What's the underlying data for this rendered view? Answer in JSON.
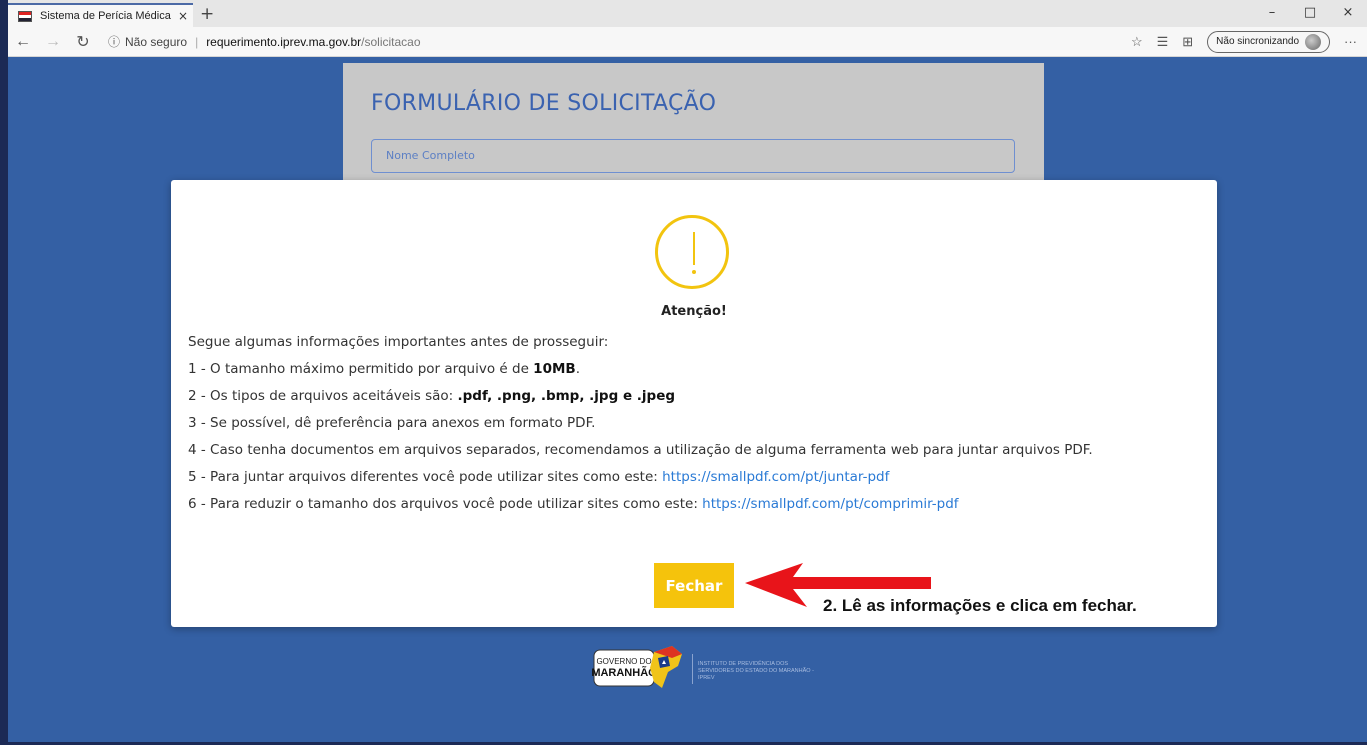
{
  "browser": {
    "tab_title": "Sistema de Perícia Médica",
    "tab_close": "×",
    "new_tab": "+",
    "window_controls": [
      "–",
      "□",
      "×"
    ],
    "security_label": "Não seguro",
    "url_host": "requerimento.iprev.ma.gov.br",
    "url_path": "/solicitacao",
    "sync_label": "Não sincronizando"
  },
  "form": {
    "title": "FORMULÁRIO DE SOLICITAÇÃO",
    "name_placeholder": "Nome Completo"
  },
  "modal": {
    "title": "Atenção!",
    "intro": "Segue algumas informações importantes antes de prosseguir:",
    "item1_prefix": "1 - O tamanho máximo permitido por arquivo é de ",
    "item1_bold": "10MB",
    "item1_suffix": ".",
    "item2_prefix": "2 - Os tipos de arquivos aceitáveis são: ",
    "item2_bold": ".pdf, .png, .bmp, .jpg e .jpeg",
    "item3": "3 - Se possível, dê preferência para anexos em formato PDF.",
    "item4": "4 - Caso tenha documentos em arquivos separados, recomendamos a utilização de alguma ferramenta web para juntar arquivos PDF.",
    "item5_prefix": "5 - Para juntar arquivos diferentes você pode utilizar sites como este: ",
    "item5_link": "https://smallpdf.com/pt/juntar-pdf",
    "item6_prefix": "6 - Para reduzir o tamanho dos arquivos você pode utilizar sites como este: ",
    "item6_link": "https://smallpdf.com/pt/comprimir-pdf",
    "close_button": "Fechar",
    "annotation": "2. Lê as informações e clica em fechar."
  },
  "footer": {
    "gov_logo_text": "GOVERNO DO MARANHÃO",
    "iprev_text": "INSTITUTO DE PREVIDÊNCIA DOS SERVIDORES DO ESTADO DO MARANHÃO - IPREV"
  },
  "colors": {
    "page_bg": "#3460a4",
    "accent_yellow": "#f5c30c",
    "link": "#2a7ad5",
    "annotation_arrow": "#e8141a"
  }
}
